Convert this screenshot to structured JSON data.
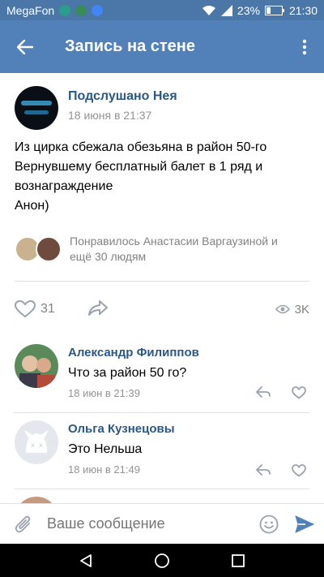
{
  "status_bar": {
    "carrier": "MegaFon",
    "battery": "23%",
    "time": "21:30"
  },
  "app_bar": {
    "title": "Запись на стене"
  },
  "post": {
    "author": "Подслушано Нея",
    "time": "18 июня в 21:37",
    "lines": [
      "Из цирка сбежала обезьяна в район 50-го",
      "Вернувшему бесплатный балет в 1 ряд и",
      "вознаграждение",
      "Анон)"
    ],
    "liked_by_line1": "Понравилось Анастасии Варгаузиной и",
    "liked_by_line2": "ещё 30 людям",
    "like_count": "31",
    "views_count": "3K"
  },
  "comments": [
    {
      "author": "Александр Филиппов",
      "text": "Что за район 50 го?",
      "time": "18 июн в 21:39"
    },
    {
      "author": "Ольга Кузнецовы",
      "text": "Это Нельша",
      "time": "18 июн в 21:49"
    }
  ],
  "composer": {
    "placeholder": "Ваше сообщение"
  },
  "colors": {
    "status_bar": "#4a76a8",
    "app_bar": "#5181b8",
    "link": "#2a5885",
    "muted": "#939393"
  },
  "icons": {
    "back": "arrow-left-icon",
    "more": "more-vertical-icon",
    "like": "heart-icon",
    "share": "share-arrow-icon",
    "views": "eye-icon",
    "reply": "reply-icon",
    "attach": "paperclip-icon",
    "emoji": "smiley-icon",
    "send": "send-icon"
  }
}
